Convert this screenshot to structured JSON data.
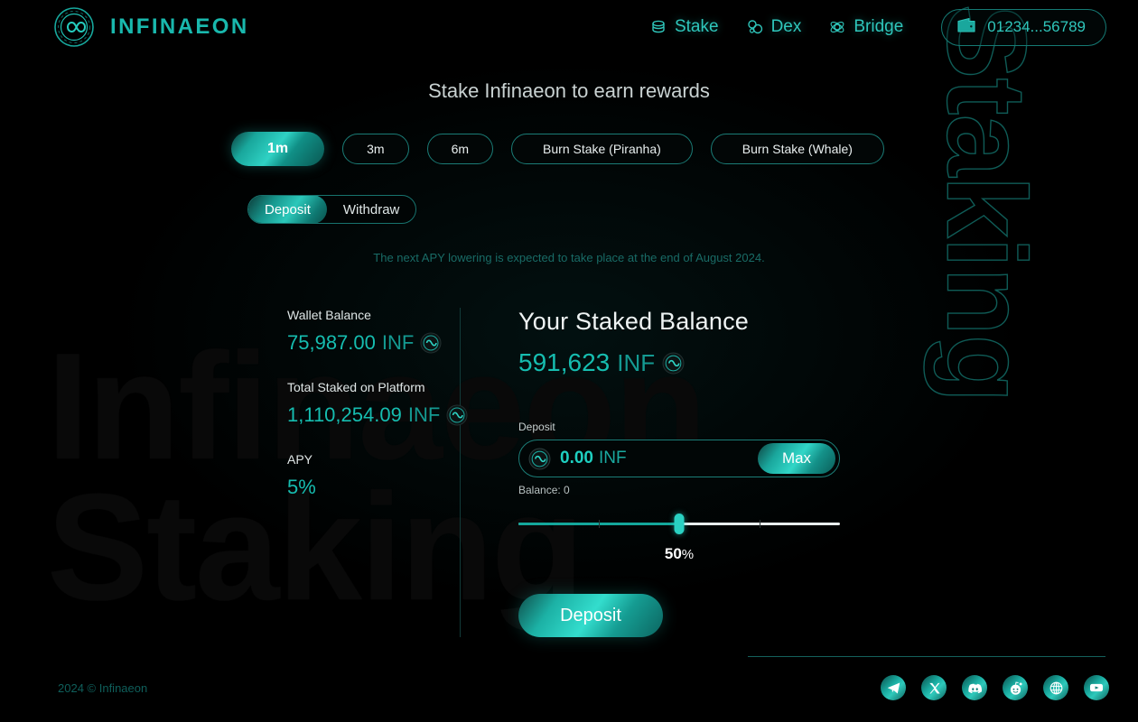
{
  "brand": {
    "name": "INFINAEON",
    "logo_icon": "infinity-circle-logo"
  },
  "nav": {
    "items": [
      {
        "label": "Stake",
        "icon": "coins-icon"
      },
      {
        "label": "Dex",
        "icon": "molecule-icon"
      },
      {
        "label": "Bridge",
        "icon": "atom-icon"
      }
    ],
    "wallet": {
      "address": "01234...56789",
      "icon": "wallet-icon"
    }
  },
  "page": {
    "title": "Stake Infinaeon to earn rewards",
    "notice": "The next APY lowering is expected to take place at the end of August 2024.",
    "watermark_line1": "Infinaeon",
    "watermark_line2": "Staking",
    "side_watermark": "Staking"
  },
  "durations": {
    "options": [
      {
        "label": "1m",
        "active": true
      },
      {
        "label": "3m",
        "active": false
      },
      {
        "label": "6m",
        "active": false
      },
      {
        "label": "Burn Stake (Piranha)",
        "active": false
      },
      {
        "label": "Burn Stake (Whale)",
        "active": false
      }
    ]
  },
  "mode": {
    "options": [
      {
        "label": "Deposit",
        "active": true
      },
      {
        "label": "Withdraw",
        "active": false
      }
    ]
  },
  "stats": [
    {
      "label": "Wallet Balance",
      "value": "75,987.00",
      "unit": "INF",
      "icon": "inf-token-icon"
    },
    {
      "label": "Total Staked on Platform",
      "value": "1,110,254.09",
      "unit": "INF",
      "icon": "inf-token-icon"
    },
    {
      "label": "APY",
      "value": "5%",
      "unit": "",
      "icon": ""
    }
  ],
  "staked": {
    "title": "Your Staked Balance",
    "value": "591,623",
    "unit": "INF",
    "icon": "inf-token-icon"
  },
  "deposit_form": {
    "field_label": "Deposit",
    "amount": "0.00",
    "currency": "INF",
    "placeholder": "0.00",
    "max_label": "Max",
    "balance_note": "Balance: 0",
    "slider_percent": 50,
    "slider_value_label": "50",
    "slider_percent_symbol": "%",
    "submit_label": "Deposit"
  },
  "footer": {
    "copyright": "2024 © Infinaeon",
    "socials": [
      {
        "name": "telegram-icon"
      },
      {
        "name": "x-twitter-icon"
      },
      {
        "name": "discord-icon"
      },
      {
        "name": "reddit-icon"
      },
      {
        "name": "website-globe-icon"
      },
      {
        "name": "youtube-icon"
      }
    ]
  },
  "colors": {
    "accent": "#16bdb0",
    "accent_bright": "#2ed3c4",
    "background": "#000000",
    "text": "#e6eded"
  }
}
